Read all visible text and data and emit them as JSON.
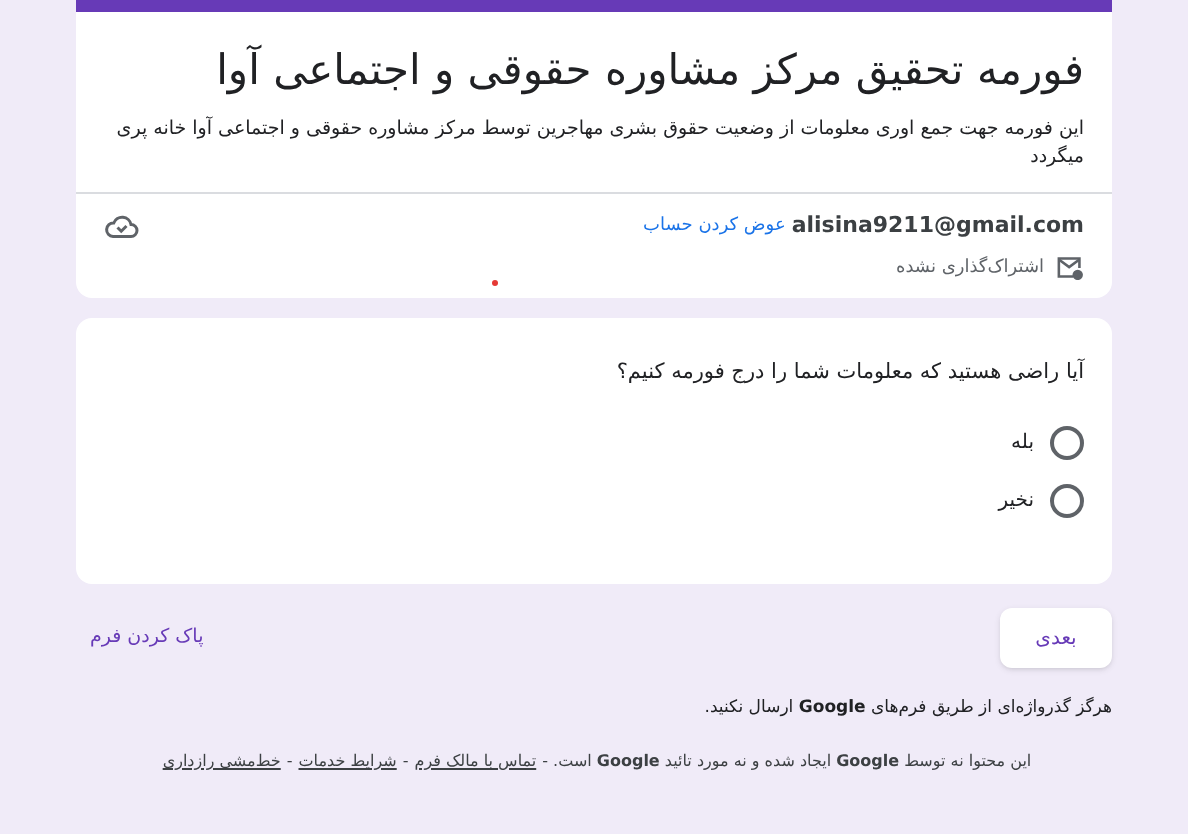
{
  "header": {
    "title": "فورمه تحقیق مرکز مشاوره حقوقی و اجتماعی آوا",
    "description": "این فورمه جهت جمع اوری معلومات از وضعیت حقوق بشری مهاجرین توسط مرکز مشاوره حقوقی و اجتماعی آوا خانه پری میگردد"
  },
  "account": {
    "email": "alisina9211@gmail.com",
    "switch_link": "عوض کردن حساب",
    "sharing_status": "اشتراک‌گذاری نشده"
  },
  "question": {
    "text": "آیا راضی هستید که معلومات شما را درج فورمه کنیم؟",
    "options": [
      {
        "label": "بله",
        "selected": false
      },
      {
        "label": "نخیر",
        "selected": false
      }
    ]
  },
  "next_button": "بعدی",
  "clear_form": "پاک کردن فرم",
  "password_warning": "هرگز گذرواژه‌ای از طریق فرم‌های **Google** ارسال نکنید.",
  "notice_parts": [
    {
      "kind": "text",
      "text": "این محتوا نه توسط **Google** ایجاد شده و نه مورد تائید **Google** است. -"
    },
    {
      "kind": "link",
      "text": "تماس با مالک فرم"
    },
    {
      "kind": "text",
      "text": "-"
    },
    {
      "kind": "link",
      "text": "شرایط خدمات"
    },
    {
      "kind": "text",
      "text": "-"
    },
    {
      "kind": "link",
      "text": "خط‌مشی رازداری"
    }
  ]
}
